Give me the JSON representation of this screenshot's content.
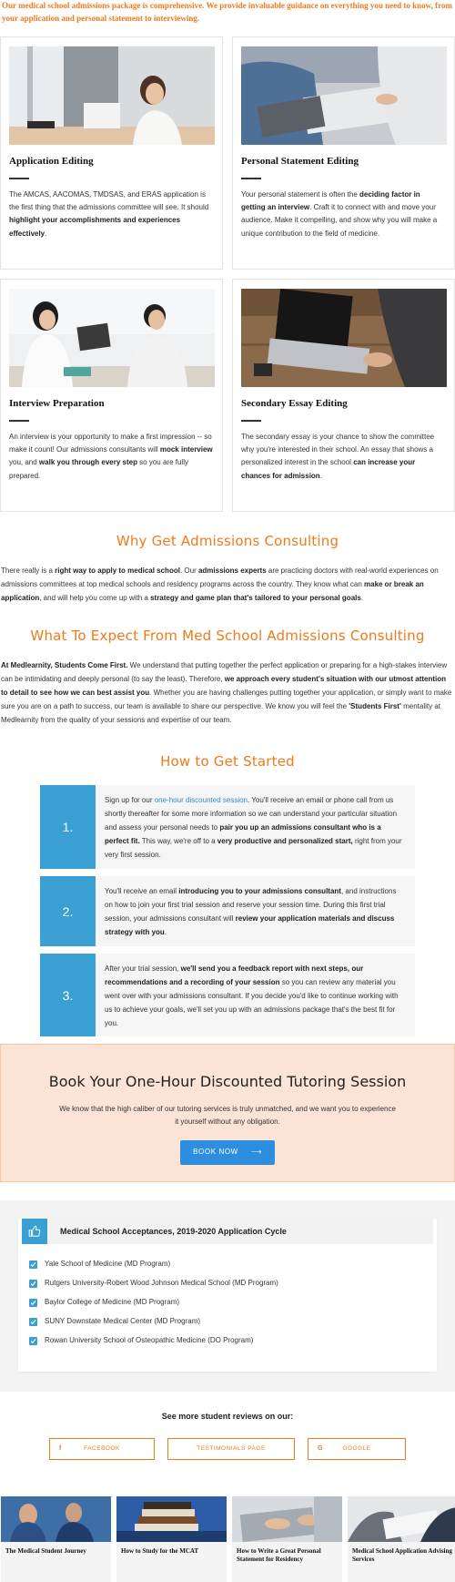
{
  "intro": {
    "lead": "Our medical school admissions package is comprehensive. We provide invaluable guidance on everything you need to know, from your application and personal statement to interviewing."
  },
  "cards": [
    {
      "title": "Application Editing",
      "p1": "The AMCAS, AACOMAS, TMDSAS, and ERAS application is the first thing that the admissions committee will see. It should ",
      "b1": "highlight your accomplishments and experiences effectively",
      "p2": "."
    },
    {
      "title": "Personal Statement Editing",
      "p1": "Your personal statement is often the ",
      "b1": "deciding factor in getting an interview",
      "p2": ". Craft it to connect with and move your audience. Make it compelling, and show why you will make a unique contribution to the field of medicine."
    },
    {
      "title": "Interview Preparation",
      "p1": "An interview is your opportunity to make a first impression -- so make it count! Our admissions consultants will ",
      "b1": "mock interview",
      "p2": " you, and ",
      "b2": "walk you through every step",
      "p3": " so you are fully prepared."
    },
    {
      "title": "Secondary Essay Editing",
      "p1": "The secondary essay is your chance to show the committee why you're interested in their school. An essay that shows a personalized interest in the school ",
      "b1": "can increase your chances for admission",
      "p2": "."
    }
  ],
  "why": {
    "heading": "Why Get Admissions Consulting",
    "t1": "There really is a ",
    "b1": "right way to apply to medical school",
    "t2": ". Our ",
    "b2": "admissions experts",
    "t3": " are practicing doctors with real-world experiences on admissions committees at top medical schools and residency programs across the country. They know what can ",
    "b3": "make or break an application",
    "t4": ", and will help you come up with a ",
    "b4": "strategy and game plan that's tailored to your personal goals",
    "t5": "."
  },
  "expect": {
    "heading": "What To Expect From Med School Admissions Consulting",
    "b1": "At Medlearnity, Students Come First.",
    "t1": " We understand that putting together the perfect application or preparing for a high-stakes interview can be intimidating and deeply personal (to say the least). Therefore, ",
    "b2": "we approach every student's situation with our utmost attention to detail to see how we can best assist you",
    "t2": ". Whether you are having challenges putting together your application, or simply want to make sure you are on a path to success, our team is available to share our perspective. We know you will feel the ",
    "b3": "'Students First'",
    "t3": " mentality at Medlearnity from the quality of your sessions and expertise of our team."
  },
  "start": {
    "heading": "How to Get Started",
    "steps": [
      {
        "num": "1.",
        "t1": "Sign up for our ",
        "link": "one-hour discounted session",
        "t2": ". You'll receive an email or phone call from us shortly thereafter for some more information so we can understand your particular situation and assess your personal needs to ",
        "b1": "pair you up an admissions consultant who is a perfect fit.",
        "t3": " This way, we're off to a ",
        "b2": "very productive and personalized start,",
        "t4": " right from your very first session."
      },
      {
        "num": "2.",
        "t1": "You'll receive an email ",
        "b1": "introducing you to your admissions consultant",
        "t2": ", and instructions on how to join your first trial session and reserve your session time. During this first trial session, your admissions consultant will ",
        "b2": "review your application materials and discuss strategy with you",
        "t3": "."
      },
      {
        "num": "3.",
        "t1": "After your trial session, ",
        "b1": "we'll send you a feedback report with next steps, our recommendations and a recording of your session",
        "t2": " so you can review any material you went over with your admissions consultant. If you decide you'd like to continue working with us to achieve your goals, we'll set you up with an admissions package that's the best fit for you."
      }
    ]
  },
  "book": {
    "heading": "Book Your One-Hour Discounted Tutoring Session",
    "text": "We know that the high caliber of our tutoring services is truly unmatched, and we want you to experience it yourself without any obligation.",
    "button": "BOOK NOW",
    "arrow": "⟶"
  },
  "acceptances": {
    "title": "Medical School Acceptances, 2019-2020 Application Cycle",
    "items": [
      "Yale School of Medicine (MD Program)",
      "Rutgers University-Robert Wood Johnson Medical School (MD Program)",
      "Baylor College of Medicine (MD Program)",
      "SUNY Downstate Medical Center (MD Program)",
      "Rowan University School of Osteopathic Medicine (DO Program)"
    ]
  },
  "reviews": {
    "heading": "See more student reviews on our:",
    "facebook": "FACEBOOK",
    "facebook_icon": "f",
    "testimonials": "TESTIMONIALS PAGE",
    "google": "GOOGLE",
    "google_icon": "G"
  },
  "posts": [
    "The Medical Student Journey",
    "How to Study for the MCAT",
    "How to Write a Great Personal Statement for Residency",
    "Medical School Application Advising Services"
  ],
  "colors": {
    "accent_orange": "#f07a1a",
    "accent_blue": "#3aa0d4",
    "book_bg": "#fbe4d5",
    "button_blue": "#2d8ee0"
  }
}
